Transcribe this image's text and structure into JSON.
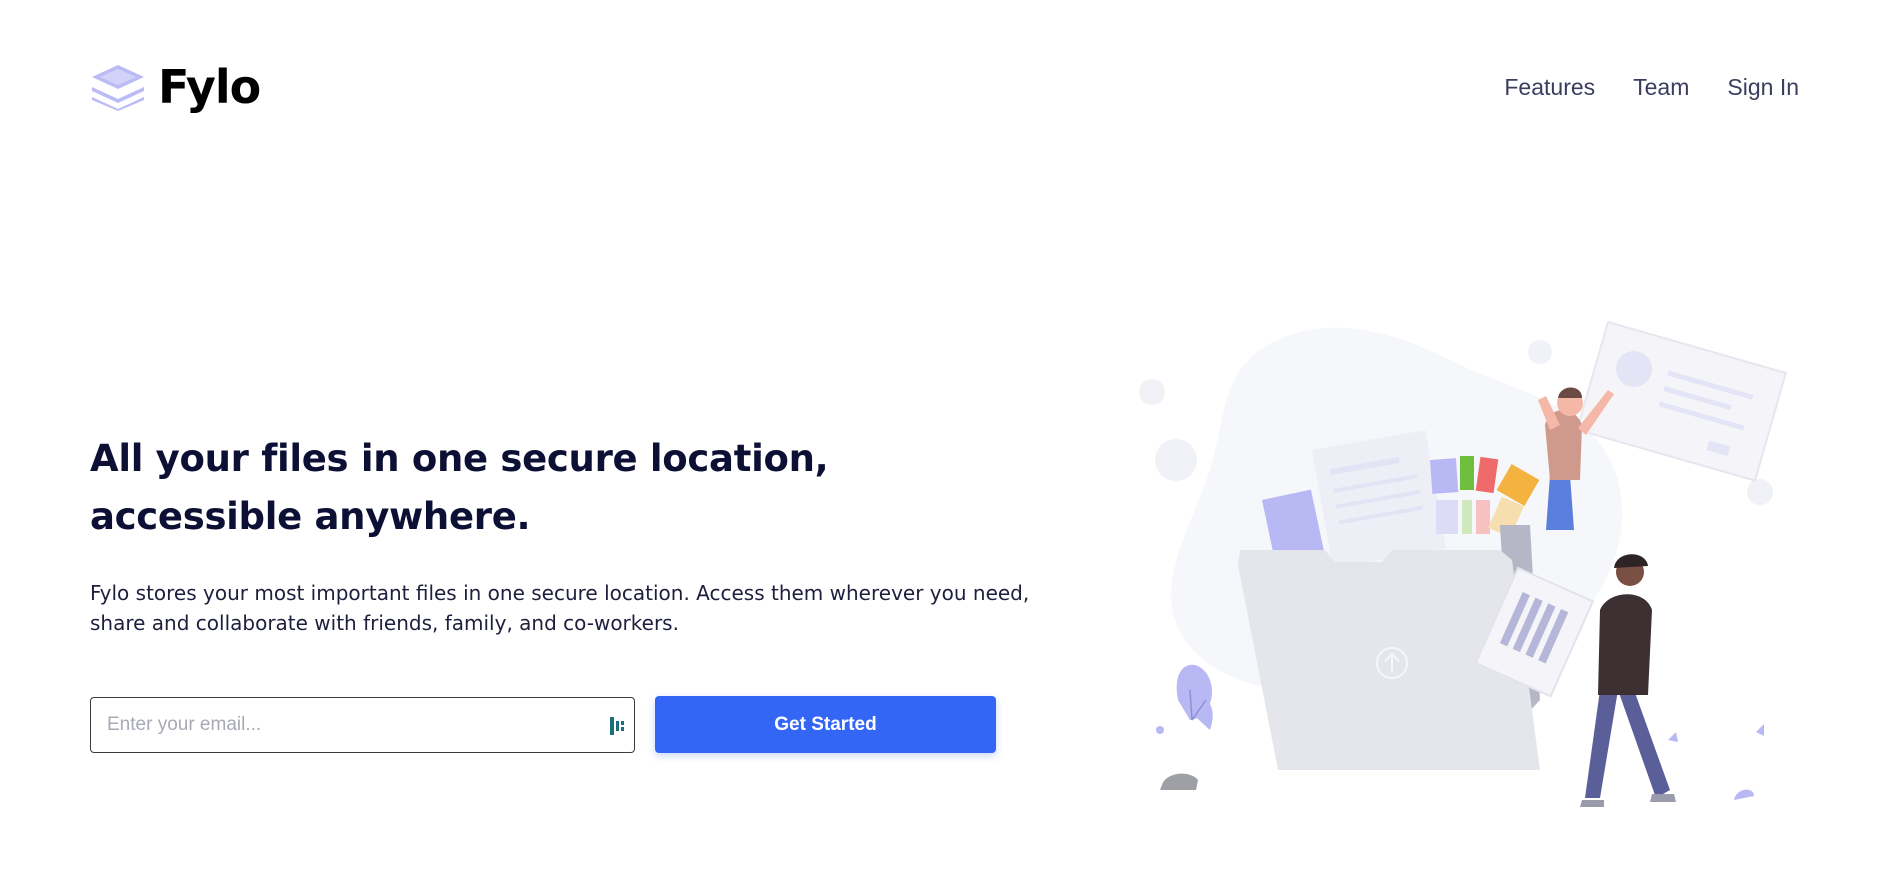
{
  "brand": {
    "name": "Fylo",
    "accent_color": "#3366f5",
    "logo_color": "#bbbcf6"
  },
  "nav": {
    "items": [
      {
        "label": "Features"
      },
      {
        "label": "Team"
      },
      {
        "label": "Sign In"
      }
    ]
  },
  "hero": {
    "title": "All your files in one secure location, accessible anywhere.",
    "description": "Fylo stores your most important files in one secure location. Access them wherever you need, share and collaborate with friends, family, and co-workers."
  },
  "form": {
    "email_placeholder": "Enter your email...",
    "email_value": "",
    "submit_label": "Get Started"
  },
  "illustration": {
    "icon": "file-upload-illustration"
  }
}
